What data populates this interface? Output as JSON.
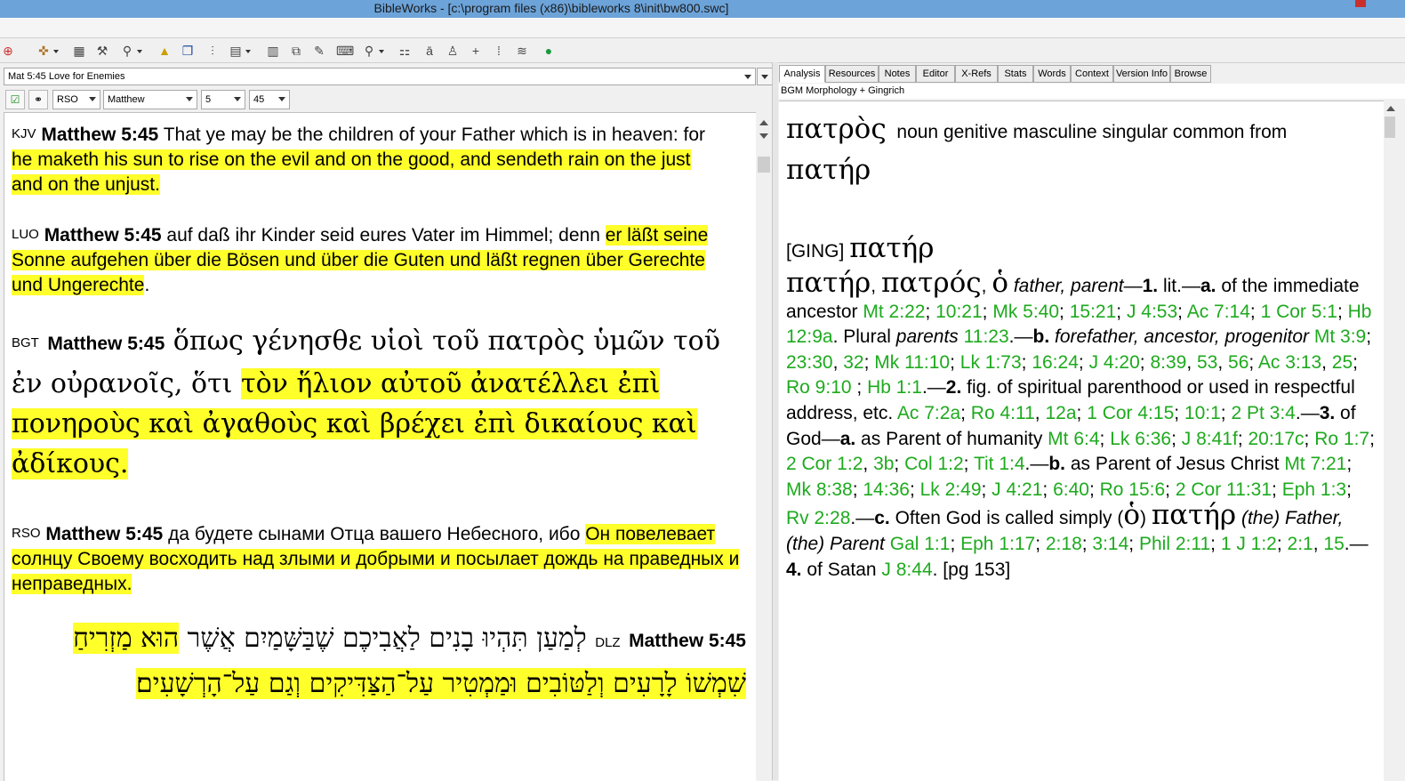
{
  "window": {
    "title": "BibleWorks - [c:\\program files (x86)\\bibleworks 8\\init\\bw800.swc]"
  },
  "toolbar": {
    "icons": [
      "crosshair-icon",
      "target-dd-icon",
      "library-icon",
      "tools-icon",
      "search-dd-icon",
      "highlight-icon",
      "windows-icon",
      "parse-icon",
      "grid-dd-icon",
      "table-icon",
      "copy-icon",
      "edit-icon",
      "keyboard-icon",
      "search-dd2-icon",
      "config-icon",
      "notes-icon",
      "lexicon-icon",
      "plus-icon",
      "verse-icon",
      "word-icon",
      "globe-icon"
    ]
  },
  "left": {
    "verse_combo": "Mat 5:45 Love for Enemies",
    "version_select": "RSO",
    "book_select": "Matthew",
    "chapter_select": "5",
    "verse_select": "45",
    "verses": {
      "kjv": {
        "version": "KJV",
        "ref": "Matthew 5:45",
        "text_plain": " That ye may be the children of your Father which is in heaven: for ",
        "text_hl": "he maketh his sun to rise on the evil and on the good, and sendeth rain on the just and on the unjust."
      },
      "luo": {
        "version": "LUO",
        "ref": "Matthew 5:45",
        "text_plain": " auf daß ihr Kinder seid eures Vater im Himmel; denn ",
        "text_hl": "er läßt seine Sonne aufgehen über die Bösen und über die Guten und läßt regnen über Gerechte und Ungerechte",
        "text_end": "."
      },
      "bgt": {
        "version": "BGT",
        "ref": "Matthew 5:45",
        "text_plain": " ὅπως γένησθε υἱοὶ τοῦ πατρὸς ὑμῶν τοῦ ἐν οὐρανοῖς, ὅτι ",
        "text_hl": "τὸν ἥλιον αὐτοῦ ἀνατέλλει ἐπὶ πονηροὺς καὶ ἀγαθοὺς καὶ βρέχει ἐπὶ δικαίους καὶ ἀδίκους."
      },
      "rso": {
        "version": "RSO",
        "ref": "Matthew 5:45",
        "text_plain": " да будете сынами Отца вашего Небесного, ибо ",
        "text_hl": "Он повелевает солнцу Своему восходить над злыми и добрыми и посылает дождь на праведных и неправедных."
      },
      "dlz": {
        "version": "DLZ",
        "ref": "Matthew 5:45",
        "text_plain": "לְמַעַן תִּהְיוּ בָנִים לַאֲבִיכֶם שֶׁבַּשָּׁמַיִם אֲשֶׁר ",
        "text_hl": "הוּא מַזְרִיחַ שִׁמְשׁוֹ לָרָעִים וְלַטּוֹבִים וּמַמְטִיר עַל־הַצַּדִּיקִים וְגַם עַל־הָרְשָׁעִים׃"
      }
    }
  },
  "right": {
    "tabs": [
      "Analysis",
      "Resources",
      "Notes",
      "Editor",
      "X-Refs",
      "Stats",
      "Words",
      "Context",
      "Version Info",
      "Browse"
    ],
    "subheader": "BGM Morphology + Gingrich",
    "morph": {
      "word": "πατρὸς",
      "desc": "noun genitive masculine singular common from",
      "lemma": "πατήρ"
    },
    "ging": {
      "tag": "[GING]",
      "lemma": "πατήρ",
      "head1": "πατήρ",
      "head2": "πατρός",
      "head3": "ὁ",
      "p1": " father, parent",
      "n1": "1.",
      "lit": " lit.—",
      "a": "a.",
      "a_text": " of the immediate ancestor ",
      "r1": "Mt 2:22",
      "r2": "10:21",
      "r3": "Mk 5:40",
      "r4": "15:21",
      "r5": "J 4:53",
      "r6": "Ac 7:14",
      "r7": "1 Cor 5:1",
      "r8": "Hb 12:9a",
      "plural": ". Plural ",
      "parents": "parents",
      "r9": "11:23",
      "b": "b.",
      "b_text": "forefather, ancestor, progenitor",
      "r10": "Mt 3:9",
      "r11": "23:30",
      "r12": "32",
      "r13": "Mk 11:10",
      "r14": "Lk 1:73",
      "r15": "16:24",
      "r16": "J 4:20",
      "r17": "8:39",
      "r18": "53",
      "r19": "56",
      "r20": "Ac 3:13",
      "r21": "25",
      "r22": "Ro 9:10",
      "r23": "Hb 1:1",
      "n2": "2.",
      "fig": " fig. of spiritual parenthood or used in respectful address, etc. ",
      "r24": "Ac 7:2a",
      "r25": "Ro 4:11",
      "r26": "12a",
      "r27": "1 Cor 4:15",
      "r28": "10:1",
      "r29": "2 Pt 3:4",
      "n3": "3.",
      "god": " of God—",
      "a2": "a.",
      "parent_hum": " as Parent of humanity ",
      "r30": "Mt 6:4",
      "r31": "Lk 6:36",
      "r32": "J 8:41f",
      "r33": "20:17c",
      "r34": "Ro 1:7",
      "r35": "2 Cor 1:2",
      "r36": "3b",
      "r37": "Col 1:2",
      "r38": "Tit 1:4",
      "b2": "b.",
      "parent_jc": " as Parent of Jesus Christ ",
      "r39": "Mt 7:21",
      "r40": "Mk 8:38",
      "r41": "14:36",
      "r42": "Lk 2:49",
      "r43": "J 4:21",
      "r44": "6:40",
      "r45": "Ro 15:6",
      "r46": "2 Cor 11:31",
      "r47": "Eph 1:3",
      "r48": "Rv 2:28",
      "c": "c.",
      "often": " Often God is called simply (",
      "ho": "ὁ",
      "close": ")",
      "pater": "πατήρ",
      "the_father": " (the) Father, (the) Parent ",
      "r49": "Gal 1:1",
      "r50": "Eph 1:17",
      "r51": "2:18",
      "r52": "3:14",
      "r53": "Phil 2:11",
      "r54": "1 J 1:2",
      "r55": "2:1",
      "r56": "15",
      "n4": "4.",
      "satan": " of Satan ",
      "r57": "J 8:44",
      "pg": ". [pg 153]"
    }
  }
}
